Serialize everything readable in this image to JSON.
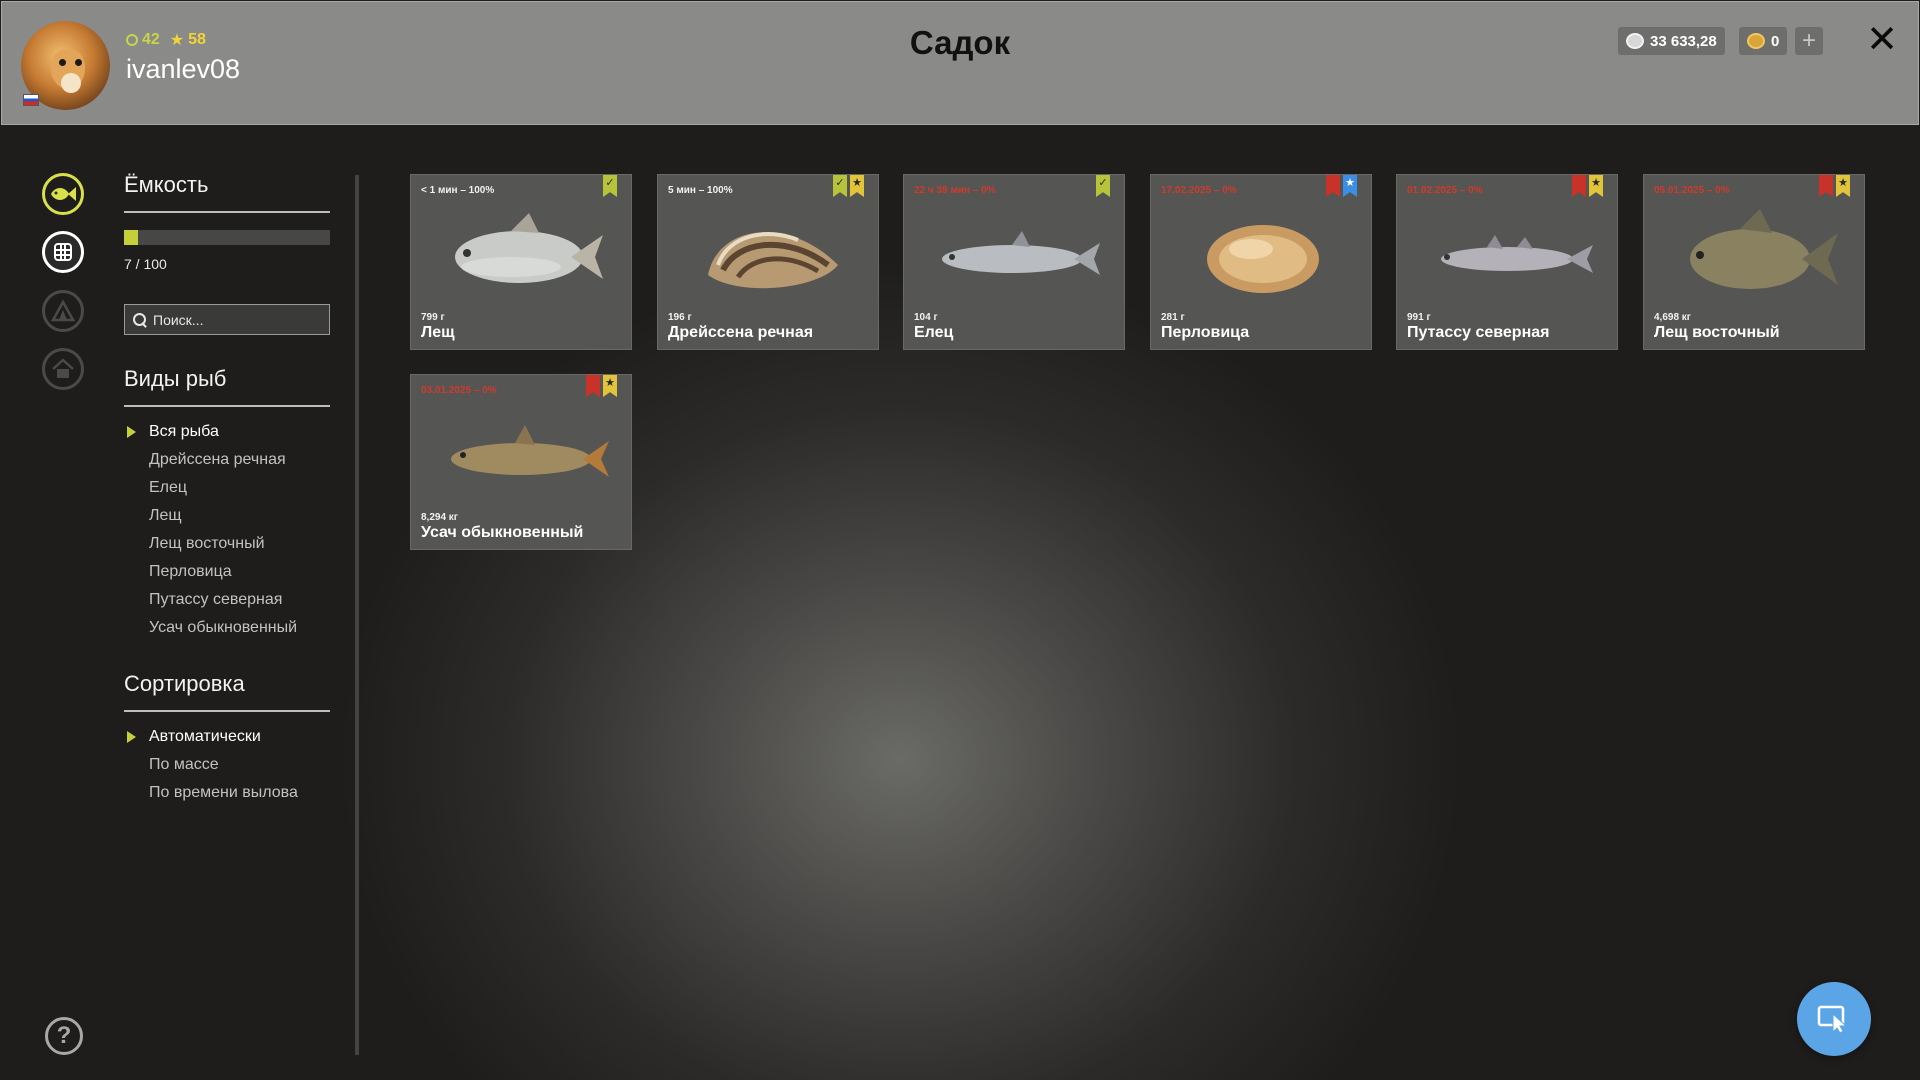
{
  "header": {
    "title": "Садок",
    "username": "ivanlev08",
    "level": "42",
    "rank": "58",
    "silver": "33 633,28",
    "gold": "0",
    "plus_label": "+",
    "close_label": "✕"
  },
  "capacity": {
    "title": "Ёмкость",
    "used": 7,
    "max": 100,
    "text": "7 / 100"
  },
  "search": {
    "placeholder": "Поиск..."
  },
  "species": {
    "title": "Виды рыб",
    "items": [
      {
        "label": "Вся рыба",
        "active": true
      },
      {
        "label": "Дрейссена речная",
        "active": false
      },
      {
        "label": "Елец",
        "active": false
      },
      {
        "label": "Лещ",
        "active": false
      },
      {
        "label": "Лещ восточный",
        "active": false
      },
      {
        "label": "Перловица",
        "active": false
      },
      {
        "label": "Путассу северная",
        "active": false
      },
      {
        "label": "Усач обыкновенный",
        "active": false
      }
    ]
  },
  "sort": {
    "title": "Сортировка",
    "items": [
      {
        "label": "Автоматически",
        "active": true
      },
      {
        "label": "По массе",
        "active": false
      },
      {
        "label": "По времени вылова",
        "active": false
      }
    ]
  },
  "cards": [
    {
      "status": "< 1 мин – 100%",
      "expired": false,
      "weight": "799 г",
      "name": "Лещ",
      "icon": "bream-image",
      "badges": [
        "green"
      ]
    },
    {
      "status": "5 мин – 100%",
      "expired": false,
      "weight": "196 г",
      "name": "Дрейссена речная",
      "icon": "zebra-mussel-image",
      "badges": [
        "green",
        "gold"
      ]
    },
    {
      "status": "22 ч 39 мин – 0%",
      "expired": true,
      "weight": "104 г",
      "name": "Елец",
      "icon": "dace-image",
      "badges": [
        "green"
      ]
    },
    {
      "status": "17.02.2025 – 0%",
      "expired": true,
      "weight": "281 г",
      "name": "Перловица",
      "icon": "pearl-mussel-image",
      "badges": [
        "red",
        "blue"
      ]
    },
    {
      "status": "01.02.2025 – 0%",
      "expired": true,
      "weight": "991 г",
      "name": "Путассу северная",
      "icon": "blue-whiting-image",
      "badges": [
        "red",
        "gold"
      ]
    },
    {
      "status": "05.01.2025 – 0%",
      "expired": true,
      "weight": "4,698 кг",
      "name": "Лещ восточный",
      "icon": "eastern-bream-image",
      "badges": [
        "red",
        "gold"
      ]
    },
    {
      "status": "03.01.2025 – 0%",
      "expired": true,
      "weight": "8,294 кг",
      "name": "Усач обыкновенный",
      "icon": "barbel-image",
      "badges": [
        "red",
        "gold"
      ]
    }
  ],
  "colors": {
    "accent": "#c4cf3a",
    "expired": "#d03a2c",
    "fab": "#5ba4e6"
  },
  "help_label": "?"
}
